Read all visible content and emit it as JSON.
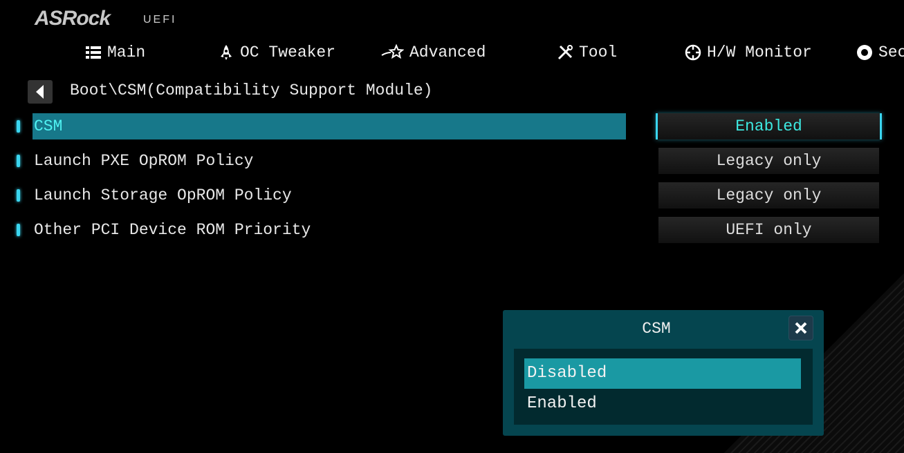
{
  "brand": {
    "logo": "ASRock",
    "product": "UEFI"
  },
  "nav": [
    {
      "label": "Main",
      "icon": "list-icon"
    },
    {
      "label": "OC Tweaker",
      "icon": "rocket-icon"
    },
    {
      "label": "Advanced",
      "icon": "star-icon"
    },
    {
      "label": "Tool",
      "icon": "tools-icon"
    },
    {
      "label": "H/W Monitor",
      "icon": "crosshair-icon"
    },
    {
      "label": "Sec",
      "icon": "shield-icon"
    }
  ],
  "breadcrumb": "Boot\\CSM(Compatibility Support Module)",
  "settings": [
    {
      "label": "CSM",
      "value": "Enabled",
      "selected": true
    },
    {
      "label": "Launch PXE OpROM Policy",
      "value": "Legacy only"
    },
    {
      "label": "Launch Storage OpROM Policy",
      "value": "Legacy only"
    },
    {
      "label": "Other PCI Device ROM Priority",
      "value": "UEFI only"
    }
  ],
  "dialog": {
    "title": "CSM",
    "options": [
      "Disabled",
      "Enabled"
    ],
    "highlighted": "Disabled"
  },
  "colors": {
    "accent": "#3ad6f0",
    "selected_row": "#17788a",
    "dialog_bg": "#05454f",
    "option_highlight": "#1a99a3"
  }
}
